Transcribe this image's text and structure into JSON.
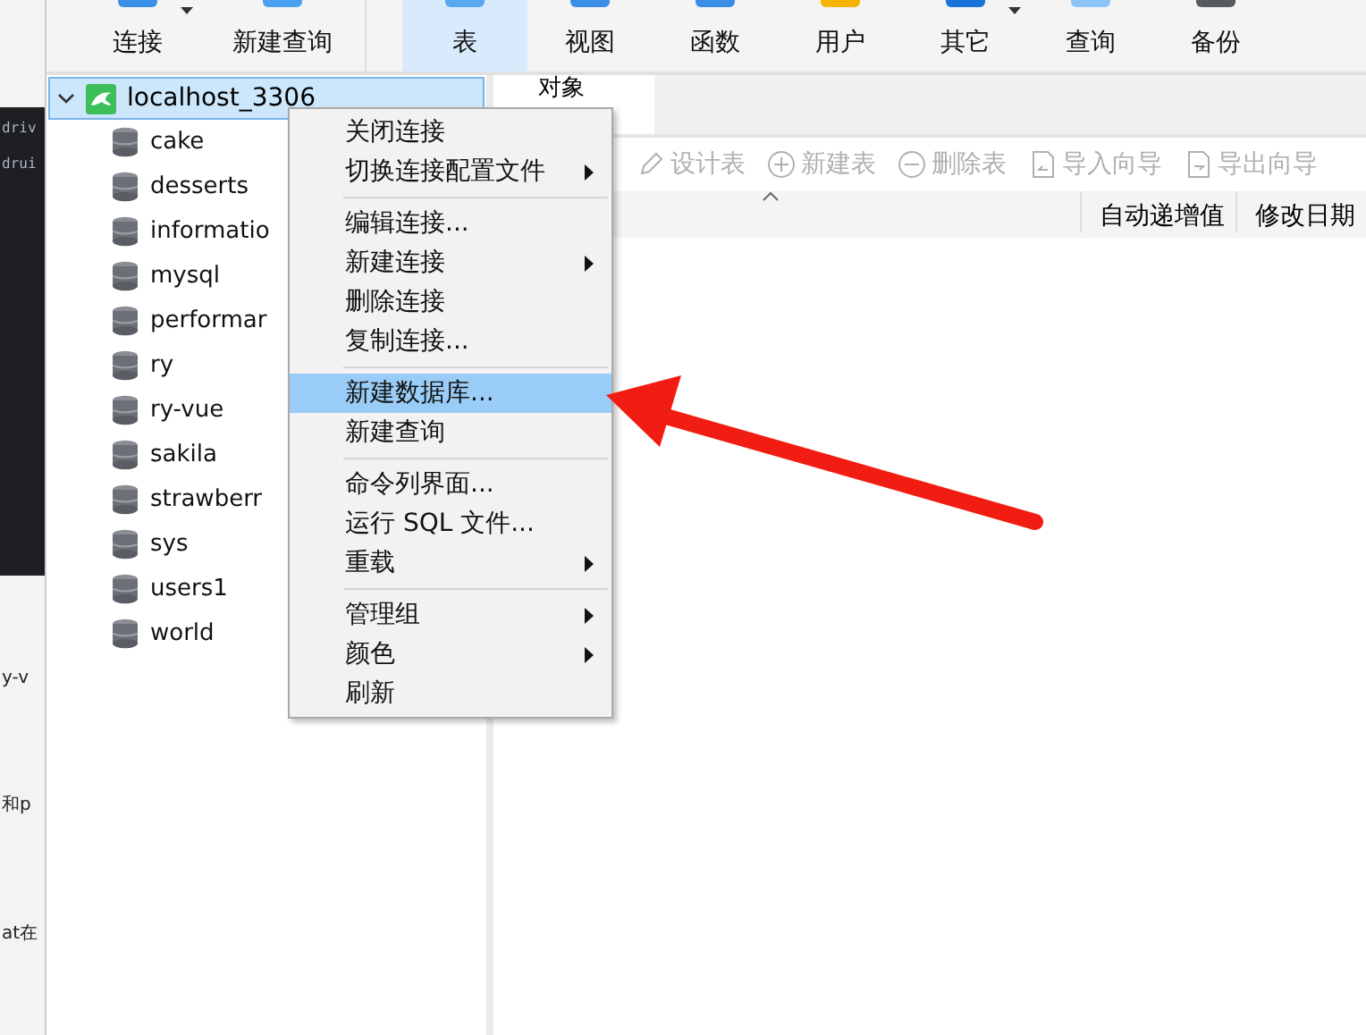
{
  "left_strip": {
    "code_lines": [
      "driv",
      "drui"
    ],
    "texts": [
      "y-v",
      "和p",
      "at在"
    ]
  },
  "toolbar": [
    {
      "label": "连接",
      "selected": false,
      "caret": true
    },
    {
      "label": "新建查询",
      "selected": false,
      "caret": false
    },
    {
      "label": "表",
      "selected": true,
      "caret": false
    },
    {
      "label": "视图",
      "selected": false,
      "caret": false
    },
    {
      "label": "函数",
      "selected": false,
      "caret": false
    },
    {
      "label": "用户",
      "selected": false,
      "caret": false
    },
    {
      "label": "其它",
      "selected": false,
      "caret": true
    },
    {
      "label": "查询",
      "selected": false,
      "caret": false
    },
    {
      "label": "备份",
      "selected": false,
      "caret": false
    }
  ],
  "tree": {
    "label": "localhost_3306",
    "expanded": true,
    "selected": true,
    "children": [
      {
        "label": "cake"
      },
      {
        "label": "desserts"
      },
      {
        "label": "informatio"
      },
      {
        "label": "mysql"
      },
      {
        "label": "performar"
      },
      {
        "label": "ry"
      },
      {
        "label": "ry-vue"
      },
      {
        "label": "sakila"
      },
      {
        "label": "strawberr"
      },
      {
        "label": "sys"
      },
      {
        "label": "users1"
      },
      {
        "label": "world"
      }
    ]
  },
  "tab": {
    "label": "对象"
  },
  "object_toolbar": [
    {
      "label": "设计表",
      "kind": "design",
      "disabled": true
    },
    {
      "label": "新建表",
      "kind": "new",
      "disabled": true
    },
    {
      "label": "删除表",
      "kind": "delete",
      "disabled": true
    },
    {
      "label": "导入向导",
      "kind": "import",
      "disabled": true
    },
    {
      "label": "导出向导",
      "kind": "export",
      "disabled": true
    }
  ],
  "columns": [
    "自动递增值",
    "修改日期"
  ],
  "context_menu": [
    {
      "kind": "item",
      "label": "关闭连接",
      "submenu": false,
      "selected": false
    },
    {
      "kind": "item",
      "label": "切换连接配置文件",
      "submenu": true,
      "selected": false
    },
    {
      "kind": "separator"
    },
    {
      "kind": "item",
      "label": "编辑连接...",
      "submenu": false,
      "selected": false
    },
    {
      "kind": "item",
      "label": "新建连接",
      "submenu": true,
      "selected": false
    },
    {
      "kind": "item",
      "label": "删除连接",
      "submenu": false,
      "selected": false
    },
    {
      "kind": "item",
      "label": "复制连接...",
      "submenu": false,
      "selected": false
    },
    {
      "kind": "separator"
    },
    {
      "kind": "item",
      "label": "新建数据库...",
      "submenu": false,
      "selected": true
    },
    {
      "kind": "item",
      "label": "新建查询",
      "submenu": false,
      "selected": false
    },
    {
      "kind": "separator"
    },
    {
      "kind": "item",
      "label": "命令列界面...",
      "submenu": false,
      "selected": false
    },
    {
      "kind": "item",
      "label": "运行 SQL 文件...",
      "submenu": false,
      "selected": false
    },
    {
      "kind": "item",
      "label": "重载",
      "submenu": true,
      "selected": false
    },
    {
      "kind": "separator"
    },
    {
      "kind": "item",
      "label": "管理组",
      "submenu": true,
      "selected": false
    },
    {
      "kind": "item",
      "label": "颜色",
      "submenu": true,
      "selected": false
    },
    {
      "kind": "item",
      "label": "刷新",
      "submenu": false,
      "selected": false
    }
  ]
}
